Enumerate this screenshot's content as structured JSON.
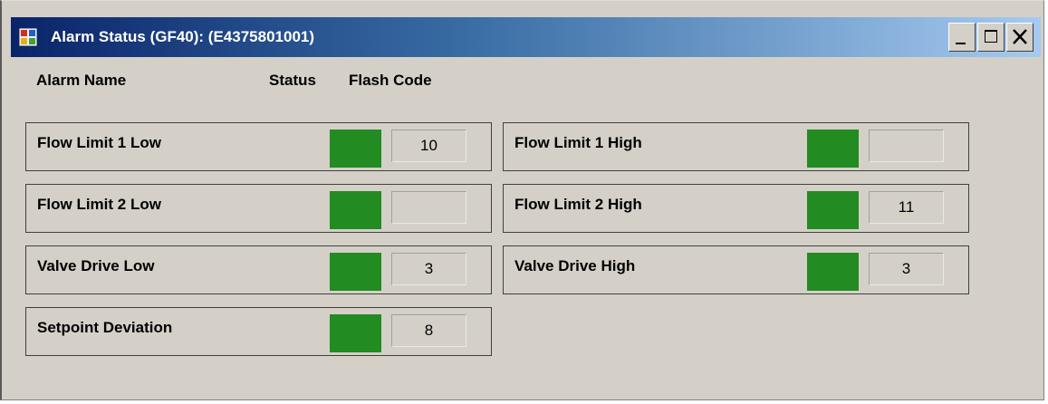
{
  "window": {
    "title": "Alarm Status (GF40): (E4375801001)",
    "controls": [
      "minimize",
      "maximize",
      "close"
    ]
  },
  "headers": {
    "name": "Alarm Name",
    "status": "Status",
    "flash": "Flash Code"
  },
  "colors": {
    "status_ok": "#228b22",
    "title_start": "#0a246a",
    "title_end": "#a6caf0"
  },
  "alarms": [
    {
      "label": "Flow Limit 1 Low",
      "flash_code": "10",
      "status": "ok"
    },
    {
      "label": "Flow Limit 1 High",
      "flash_code": "",
      "status": "ok"
    },
    {
      "label": "Flow Limit 2 Low",
      "flash_code": "",
      "status": "ok"
    },
    {
      "label": "Flow Limit 2 High",
      "flash_code": "11",
      "status": "ok"
    },
    {
      "label": "Valve Drive Low",
      "flash_code": "3",
      "status": "ok"
    },
    {
      "label": "Valve Drive High",
      "flash_code": "3",
      "status": "ok"
    },
    {
      "label": "Setpoint Deviation",
      "flash_code": "8",
      "status": "ok"
    }
  ]
}
